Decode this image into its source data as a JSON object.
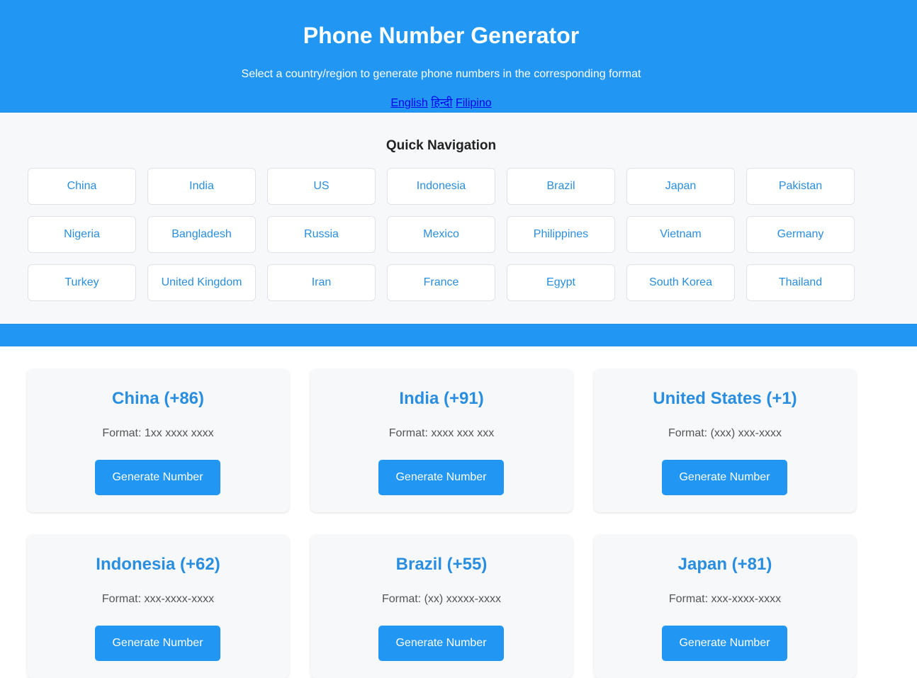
{
  "header": {
    "title": "Phone Number Generator",
    "subtitle": "Select a country/region to generate phone numbers in the corresponding format",
    "languages": [
      "English",
      "हिन्दी",
      "Filipino"
    ]
  },
  "quick_nav": {
    "title": "Quick Navigation",
    "items": [
      "China",
      "India",
      "US",
      "Indonesia",
      "Brazil",
      "Japan",
      "Pakistan",
      "Nigeria",
      "Bangladesh",
      "Russia",
      "Mexico",
      "Philippines",
      "Vietnam",
      "Germany",
      "Turkey",
      "United Kingdom",
      "Iran",
      "France",
      "Egypt",
      "South Korea",
      "Thailand"
    ]
  },
  "cards": [
    {
      "name": "China (+86)",
      "format": "Format: 1xx xxxx xxxx",
      "button": "Generate Number"
    },
    {
      "name": "India (+91)",
      "format": "Format: xxxx xxx xxx",
      "button": "Generate Number"
    },
    {
      "name": "United States (+1)",
      "format": "Format: (xxx) xxx-xxxx",
      "button": "Generate Number"
    },
    {
      "name": "Indonesia (+62)",
      "format": "Format: xxx-xxxx-xxxx",
      "button": "Generate Number"
    },
    {
      "name": "Brazil (+55)",
      "format": "Format: (xx) xxxxx-xxxx",
      "button": "Generate Number"
    },
    {
      "name": "Japan (+81)",
      "format": "Format: xxx-xxxx-xxxx",
      "button": "Generate Number"
    }
  ],
  "colors": {
    "accent": "#2196f3",
    "link_text": "#2a8ee0",
    "panel_bg": "#f7f8fa"
  }
}
